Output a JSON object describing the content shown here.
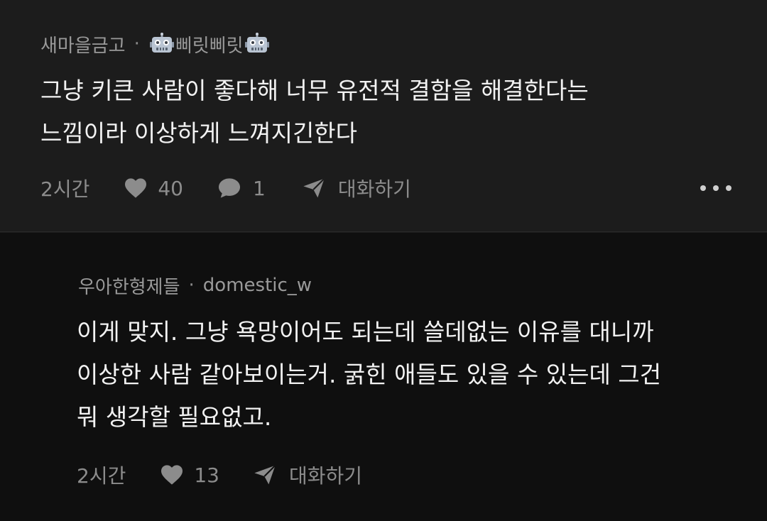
{
  "comments": [
    {
      "author": "새마을금고",
      "separator": "·",
      "nickname": "삐릿삐릿",
      "lines": [
        "그냥 키큰 사람이 좋다해 너무 유전적 결함을 해결한다는",
        "느낌이라 이상하게 느껴지긴한다"
      ],
      "time": "2시간",
      "likes": "40",
      "replies": "1",
      "reply_label": "대화하기"
    },
    {
      "author": "우아한형제들",
      "separator": "·",
      "nickname": "domestic_w",
      "lines": [
        "이게 맞지. 그냥 욕망이어도 되는데 쓸데없는 이유를 대니까",
        "이상한 사람 같아보이는거. 굵힌 애들도 있을 수 있는데 그건",
        "뭐 생각할 필요없고."
      ],
      "time": "2시간",
      "likes": "13",
      "reply_label": "대화하기"
    }
  ],
  "icons": {
    "like": "heart-icon",
    "comments": "speech-bubble-icon",
    "reply": "send-icon",
    "more": "more-dots-icon",
    "nickname_badge": "robot-icon"
  },
  "colors": {
    "background_top": "#1c1c1c",
    "background_reply": "#0f0f0f",
    "text_primary": "#f2f2f2",
    "text_secondary": "#8c8c8c"
  }
}
